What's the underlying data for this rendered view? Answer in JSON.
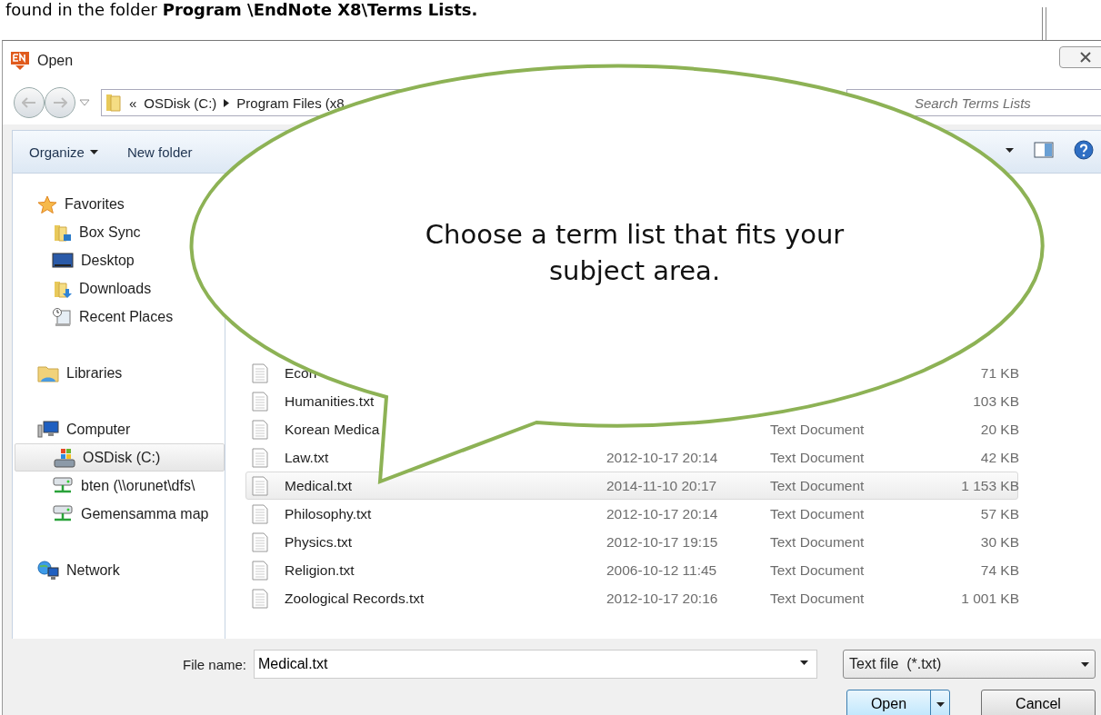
{
  "document_text": "found in the folder **Program \\EndNote X8\\Terms Lists.**",
  "window": {
    "title": "Open"
  },
  "address_bar": {
    "segments": [
      "OSDisk (C:)",
      "Program Files (x8"
    ],
    "overflow": "«"
  },
  "search": {
    "placeholder": "Search Terms Lists"
  },
  "toolbar": {
    "buttons": [
      {
        "label": "Organize",
        "kind": "menu"
      },
      {
        "label": "New folder",
        "kind": "plain"
      }
    ]
  },
  "sidebar": {
    "items": [
      {
        "label": "Favorites",
        "selected": false,
        "children": [
          {
            "label": "Box Sync",
            "selected": false
          },
          {
            "label": "Desktop",
            "selected": false
          },
          {
            "label": "Downloads",
            "selected": false
          },
          {
            "label": "Recent Places",
            "selected": false
          }
        ]
      },
      {
        "label": "Libraries",
        "selected": false
      },
      {
        "label": "Computer",
        "selected": false,
        "children": [
          {
            "label": "OSDisk (C:)",
            "selected": true
          },
          {
            "label": "bten (\\\\orunet\\dfs\\",
            "selected": false
          },
          {
            "label": "Gemensamma map",
            "selected": false
          }
        ]
      },
      {
        "label": "Network",
        "selected": false
      }
    ]
  },
  "files": [
    {
      "name": "Econ",
      "size": "71 KB",
      "selected": false
    },
    {
      "name": "Humanities.txt",
      "size": "103 KB",
      "selected": false
    },
    {
      "name": "Korean Medica",
      "type": "Text Document",
      "size": "20 KB",
      "selected": false
    },
    {
      "name": "Law.txt",
      "date": "2012-10-17 20:14",
      "type": "Text Document",
      "size": "42 KB",
      "selected": false
    },
    {
      "name": "Medical.txt",
      "date": "2014-11-10 20:17",
      "type": "Text Document",
      "size": "1 153 KB",
      "selected": true
    },
    {
      "name": "Philosophy.txt",
      "date": "2012-10-17 20:14",
      "type": "Text Document",
      "size": "57 KB",
      "selected": false
    },
    {
      "name": "Physics.txt",
      "date": "2012-10-17 19:15",
      "type": "Text Document",
      "size": "30 KB",
      "selected": false
    },
    {
      "name": "Religion.txt",
      "date": "2006-10-12 11:45",
      "type": "Text Document",
      "size": "74 KB",
      "selected": false
    },
    {
      "name": "Zoological Records.txt",
      "date": "2012-10-17 20:16",
      "type": "Text Document",
      "size": "1 001 KB",
      "selected": false
    }
  ],
  "file_name": {
    "label": "File name:",
    "value": "Medical.txt"
  },
  "file_type": {
    "value": "Text file  (*.txt)"
  },
  "buttons": [
    {
      "label": "Open",
      "kind": "split"
    },
    {
      "label": "Cancel",
      "kind": "plain"
    }
  ],
  "callout": {
    "text": "Choose a term list that fits your subject area."
  }
}
